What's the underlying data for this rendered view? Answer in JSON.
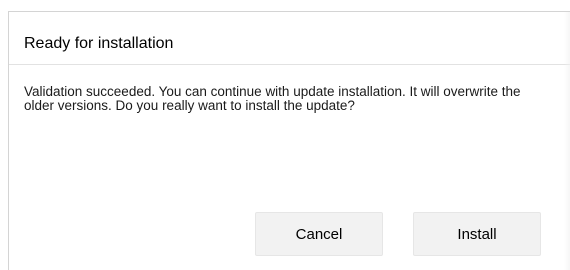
{
  "dialog": {
    "title": "Ready for installation",
    "message": "Validation succeeded. You can continue with update installation. It will overwrite the older versions. Do you really want to install the update?",
    "buttons": {
      "cancel_label": "Cancel",
      "install_label": "Install"
    }
  },
  "colors": {
    "background": "#ffffff",
    "button_background": "#f2f2f2",
    "border": "#d4d4d4"
  }
}
